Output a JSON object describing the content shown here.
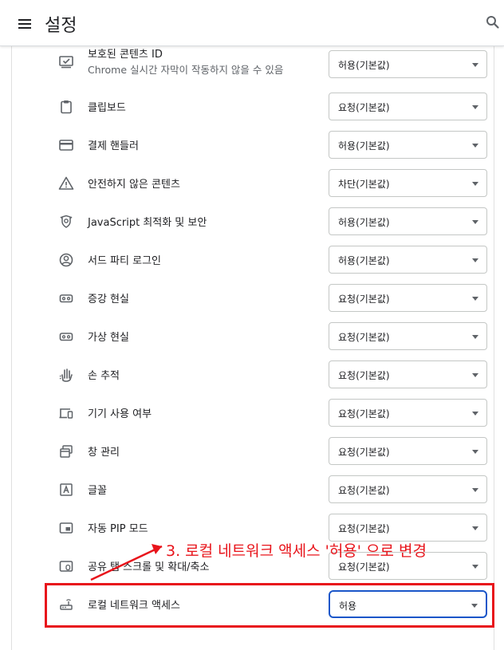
{
  "header": {
    "title": "설정"
  },
  "rows": [
    {
      "label": "보호된 콘텐츠 ID",
      "sub": "Chrome 실시간 자막이 작동하지 않을 수 있음",
      "value": "허용(기본값)",
      "icon": "protected-content-icon"
    },
    {
      "label": "클립보드",
      "value": "요청(기본값)",
      "icon": "clipboard-icon"
    },
    {
      "label": "결제 핸들러",
      "value": "허용(기본값)",
      "icon": "credit-card-icon"
    },
    {
      "label": "안전하지 않은 콘텐츠",
      "value": "차단(기본값)",
      "icon": "warning-icon"
    },
    {
      "label": "JavaScript 최적화 및 보안",
      "value": "허용(기본값)",
      "icon": "javascript-security-icon"
    },
    {
      "label": "서드 파티 로그인",
      "value": "허용(기본값)",
      "icon": "account-circle-icon"
    },
    {
      "label": "증강 현실",
      "value": "요청(기본값)",
      "icon": "vr-headset-icon"
    },
    {
      "label": "가상 현실",
      "value": "요청(기본값)",
      "icon": "vr-headset-icon"
    },
    {
      "label": "손 추적",
      "value": "요청(기본값)",
      "icon": "hand-tracking-icon"
    },
    {
      "label": "기기 사용 여부",
      "value": "요청(기본값)",
      "icon": "devices-icon"
    },
    {
      "label": "창 관리",
      "value": "요청(기본값)",
      "icon": "window-management-icon"
    },
    {
      "label": "글꼴",
      "value": "요청(기본값)",
      "icon": "font-icon"
    },
    {
      "label": "자동 PIP 모드",
      "value": "요청(기본값)",
      "icon": "picture-in-picture-icon"
    },
    {
      "label": "공유 탭 스크롤 및 확대/축소",
      "value": "요청(기본값)",
      "icon": "shared-tab-scroll-icon"
    },
    {
      "label": "로컬 네트워크 액세스",
      "value": "허용",
      "icon": "local-network-icon"
    }
  ],
  "annotation": {
    "text": "3. 로컬 네트워크 액세스 '허용' 으로 변경",
    "color": "#e8141b"
  }
}
